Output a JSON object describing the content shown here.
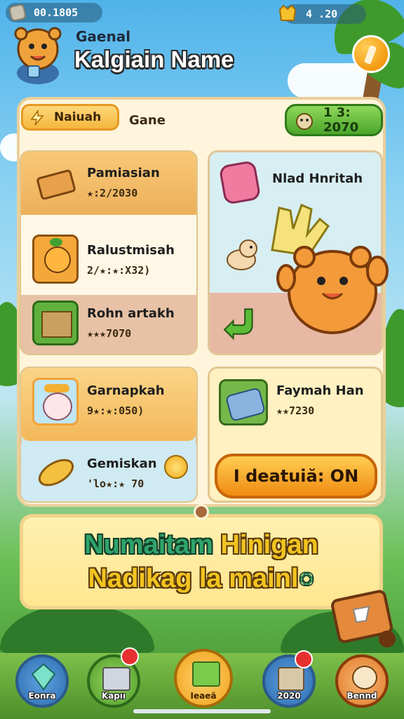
{
  "top_bar": {
    "currency_left": "00.1805",
    "currency_right": "4 .20"
  },
  "header": {
    "subtitle": "Gaenal",
    "player_name": "Kalgiain Name"
  },
  "tabs": {
    "active_label": "Naiuah",
    "second_label": "Gane",
    "timer": "1 3: 2070"
  },
  "left_cards": [
    {
      "label": "Pamiasian",
      "sub": "★:2/2030"
    },
    {
      "label": "Ralustmisah",
      "sub": "2/★:★:X32)"
    },
    {
      "label": "Rohn artakh",
      "sub": "★★★7070"
    }
  ],
  "right_card": {
    "label": "Nlad Hnritah"
  },
  "lower_left_cards": [
    {
      "label": "Garnapkah",
      "sub": "9★:★:050)"
    },
    {
      "label": "Gemiskan",
      "sub": "'lo★:★ 70"
    }
  ],
  "lower_right_card": {
    "label": "Faymah Han",
    "sub": "★★7230"
  },
  "action_button": {
    "label": "I deatuiă: ON"
  },
  "banner": {
    "line1_a": "Numaitam",
    "line1_b": "Hinigan",
    "line2": "Nadikag la mainl",
    "line2_suffix": "○"
  },
  "nav": [
    {
      "label": "Eonra"
    },
    {
      "label": "Kapıı"
    },
    {
      "label": "Ieaeä"
    },
    {
      "label": "2020"
    },
    {
      "label": "Bennd"
    }
  ],
  "colors": {
    "panel_bg": "#fff5dc",
    "accent_orange": "#f08a12",
    "accent_green": "#4aa52a",
    "banner_green": "#2fa46a",
    "banner_yellow": "#f2c420"
  }
}
